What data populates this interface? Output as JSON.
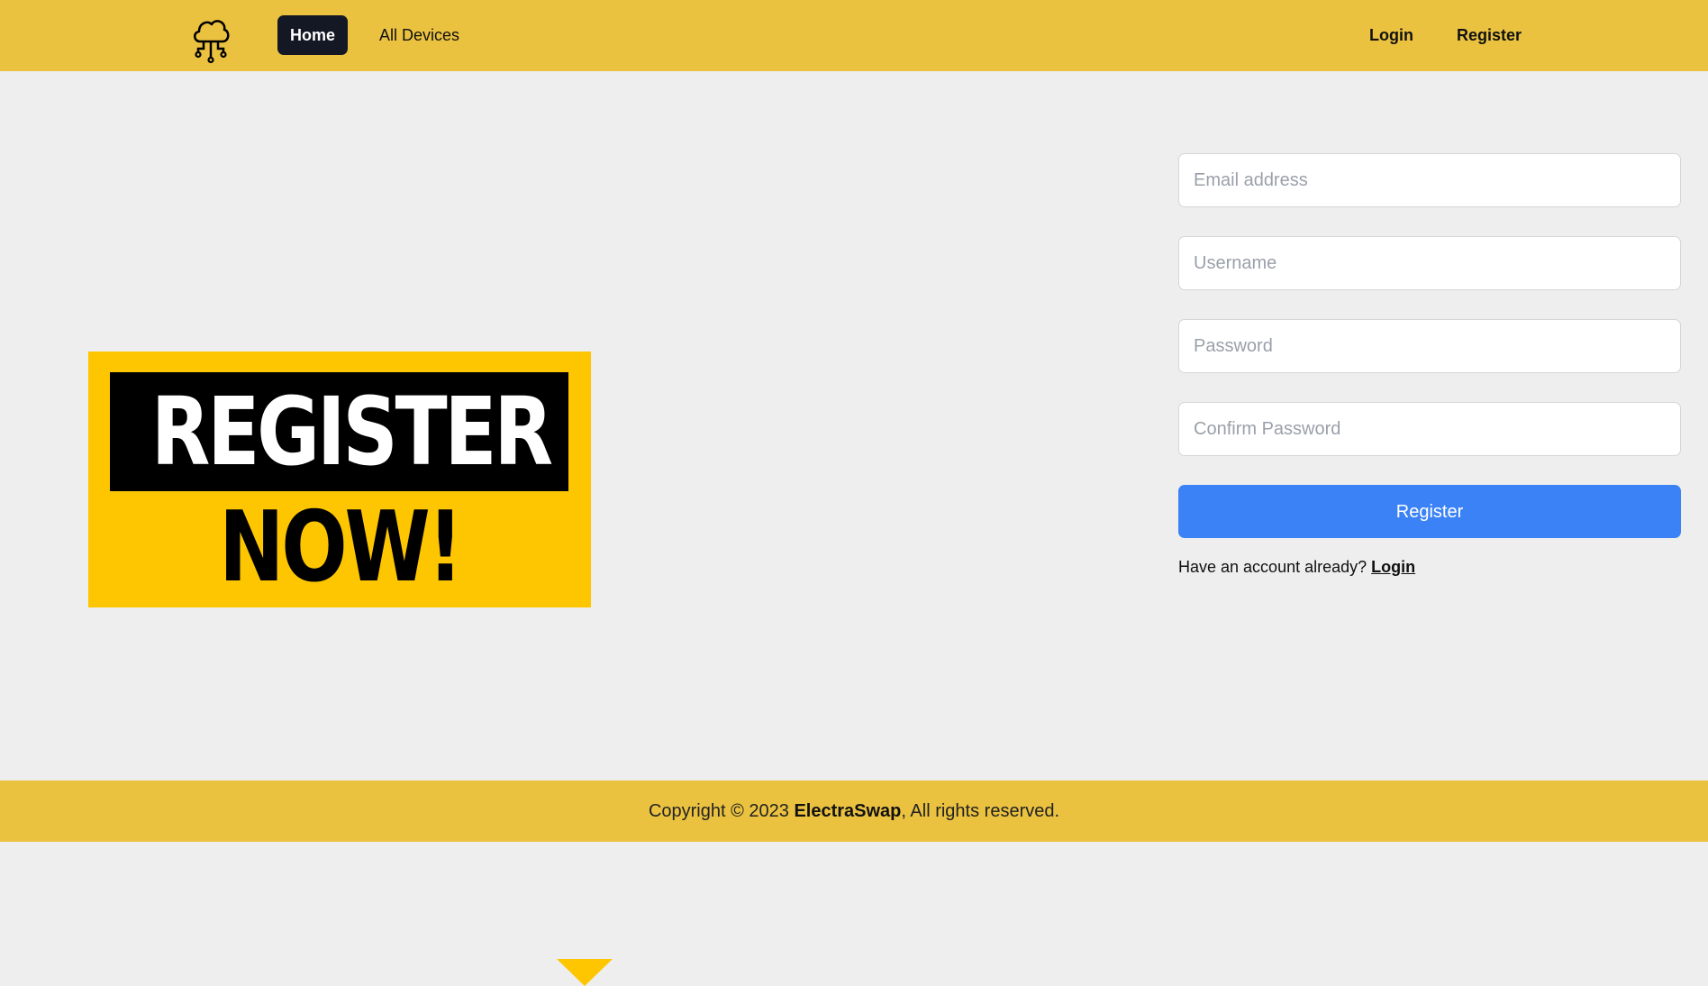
{
  "nav": {
    "logo_icon": "cloud-circuit-icon",
    "home_label": "Home",
    "devices_label": "All Devices",
    "login_label": "Login",
    "register_label": "Register"
  },
  "promo": {
    "line1": "REGISTER",
    "line2": "NOW!"
  },
  "form": {
    "email_placeholder": "Email address",
    "username_placeholder": "Username",
    "password_placeholder": "Password",
    "confirm_placeholder": "Confirm Password",
    "submit_label": "Register",
    "have_account_text": "Have an account already?",
    "login_link_label": "Login"
  },
  "footer": {
    "prefix": "Copyright © 2023 ",
    "brand": "ElectraSwap",
    "suffix": ", All rights reserved."
  },
  "colors": {
    "accent_yellow": "#ebc240",
    "promo_yellow": "#fdc600",
    "primary_blue": "#3b82f6",
    "dark_button": "#141824",
    "page_bg": "#eeeeee"
  }
}
